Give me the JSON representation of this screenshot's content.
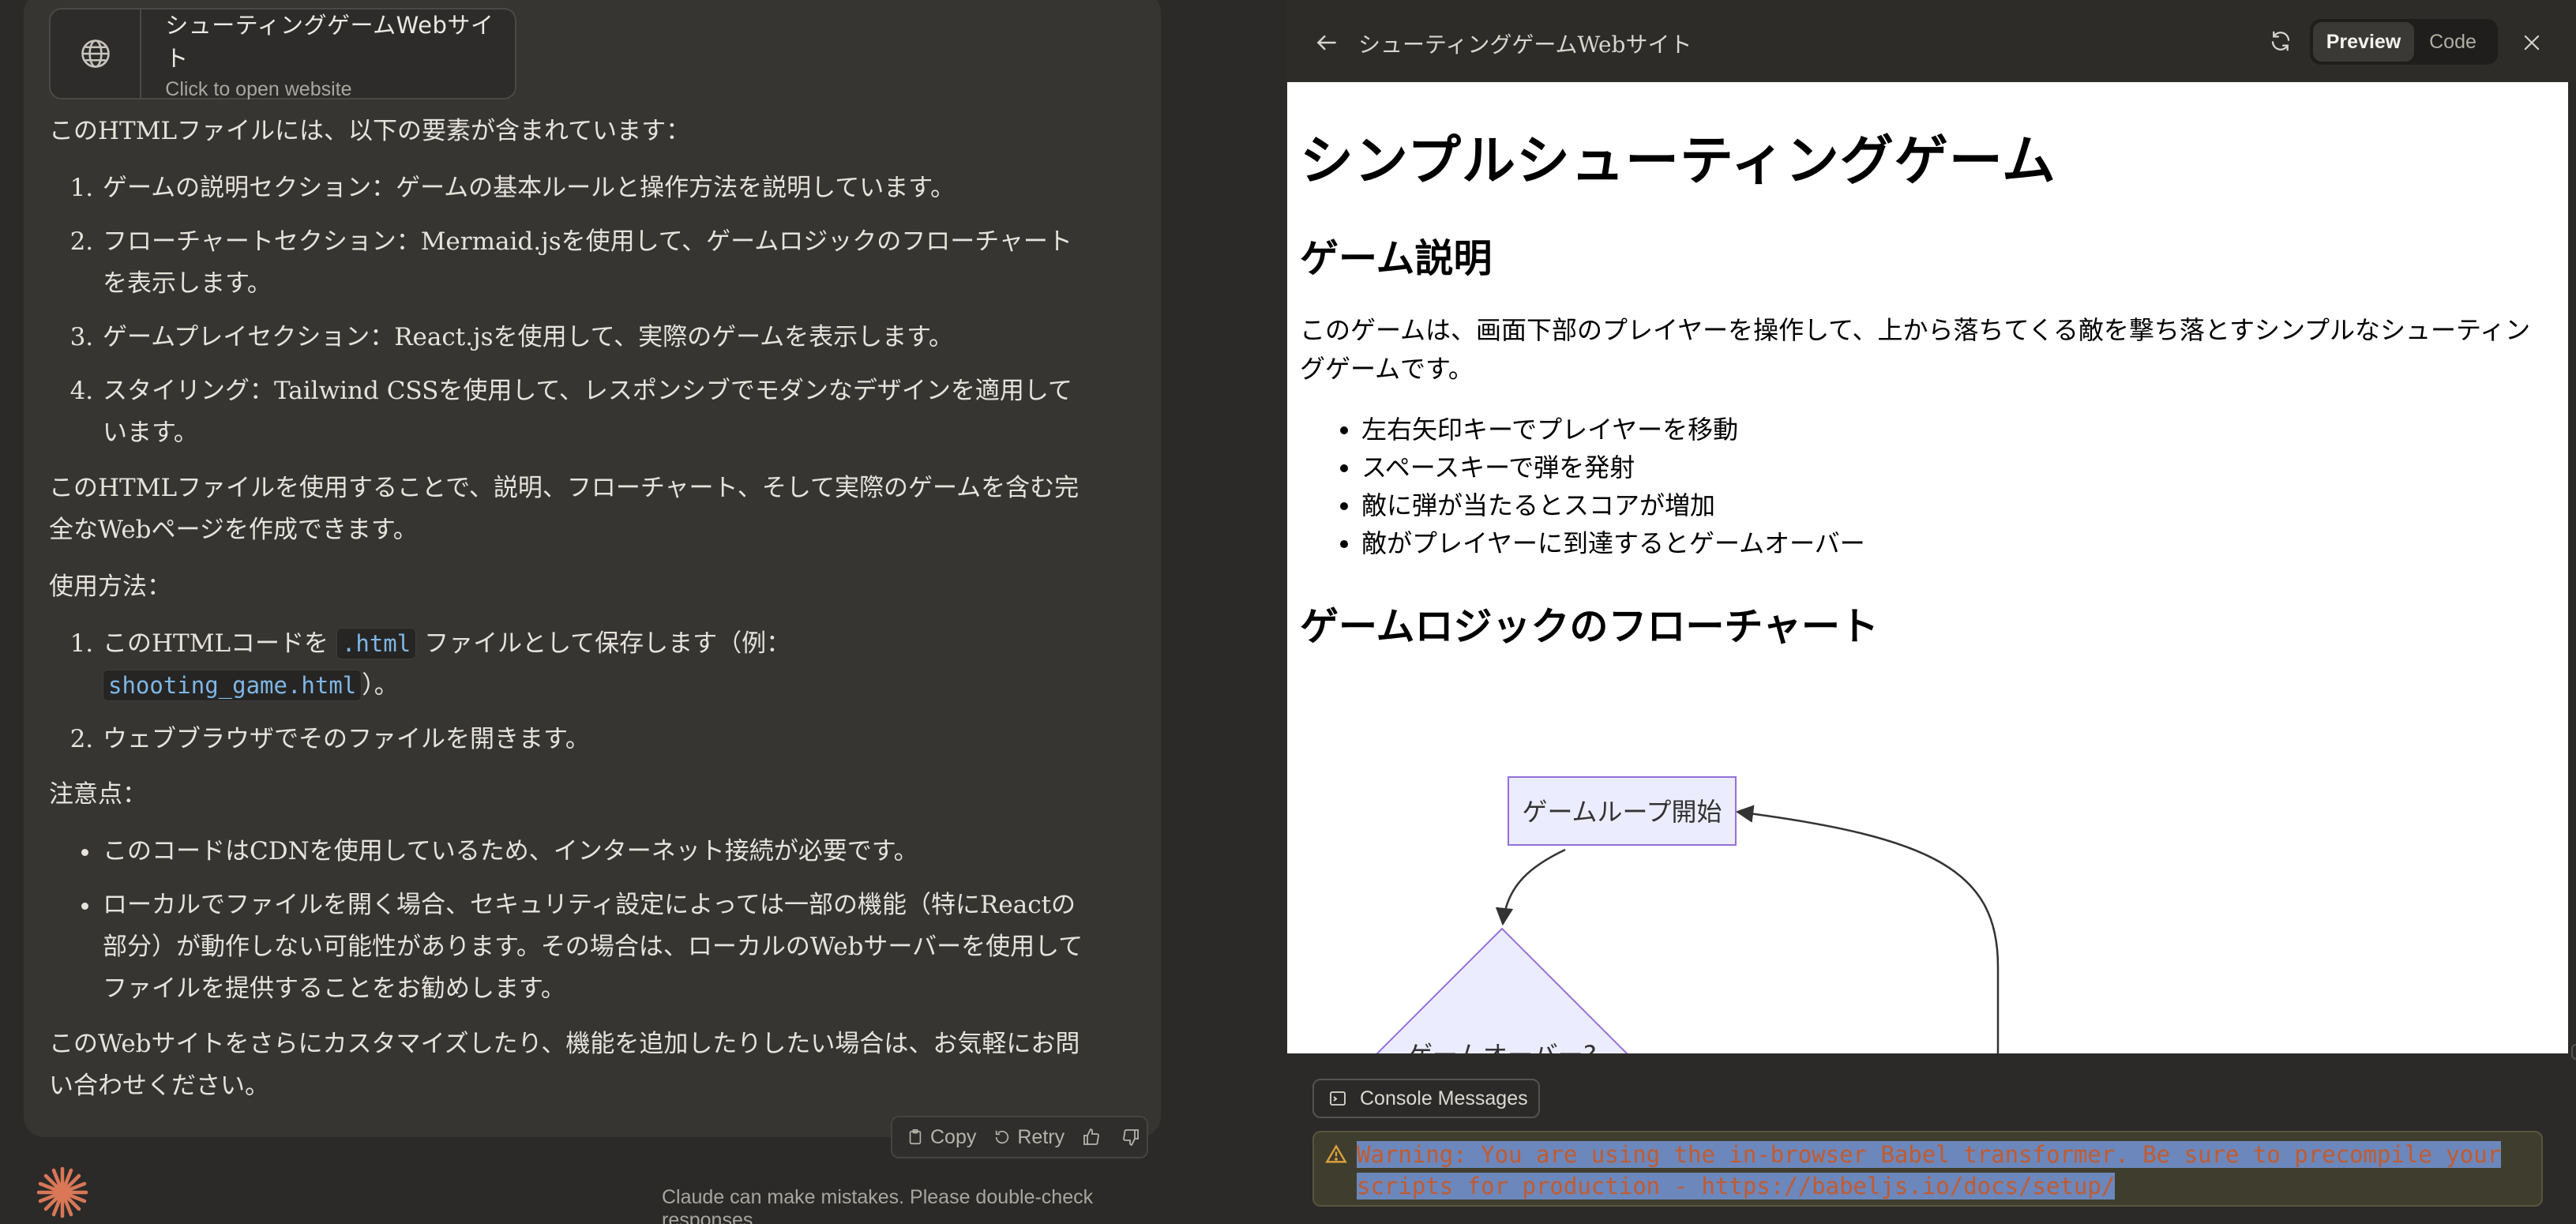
{
  "artifact_card": {
    "title": "シューティングゲームWebサイト",
    "subtitle": "Click to open website",
    "icon": "globe-icon"
  },
  "chat": {
    "intro": "このHTMLファイルには、以下の要素が含まれています：",
    "features": [
      "ゲームの説明セクション：ゲームの基本ルールと操作方法を説明しています。",
      "フローチャートセクション：Mermaid.jsを使用して、ゲームロジックのフローチャートを表示します。",
      "ゲームプレイセクション：React.jsを使用して、実際のゲームを表示します。",
      "スタイリング：Tailwind CSSを使用して、レスポンシブでモダンなデザインを適用しています。"
    ],
    "summary": "このHTMLファイルを使用することで、説明、フローチャート、そして実際のゲームを含む完全なWebページを作成できます。",
    "usage_heading": "使用方法：",
    "usage_step1_a": "このHTMLコードを",
    "usage_step1_code1": ".html",
    "usage_step1_b": "ファイルとして保存します（例：",
    "usage_step1_code2": "shooting_game.html",
    "usage_step1_c": "）。",
    "usage_step2": "ウェブブラウザでそのファイルを開きます。",
    "notes_heading": "注意点：",
    "notes": [
      "このコードはCDNを使用しているため、インターネット接続が必要です。",
      "ローカルでファイルを開く場合、セキュリティ設定によっては一部の機能（特にReactの部分）が動作しない可能性があります。その場合は、ローカルのWebサーバーを使用してファイルを提供することをお勧めします。"
    ],
    "closing": "このWebサイトをさらにカスタマイズしたり、機能を追加したりしたい場合は、お気軽にお問い合わせください。"
  },
  "actions": {
    "copy": "Copy",
    "retry": "Retry"
  },
  "disclaimer": "Claude can make mistakes. Please double-check responses.",
  "artifact_panel": {
    "title": "シューティングゲームWebサイト",
    "tabs": [
      "Preview",
      "Code"
    ],
    "active_tab": "Preview"
  },
  "preview": {
    "h1": "シンプルシューティングゲーム",
    "h2_description": "ゲーム説明",
    "description": "このゲームは、画面下部のプレイヤーを操作して、上から落ちてくる敵を撃ち落とすシンプルなシューティングゲームです。",
    "rules": [
      "左右矢印キーでプレイヤーを移動",
      "スペースキーで弾を発射",
      "敵に弾が当たるとスコアが増加",
      "敵がプレイヤーに到達するとゲームオーバー"
    ],
    "h2_flowchart": "ゲームロジックのフローチャート",
    "flow_nodes": {
      "start": "ゲームループ開始",
      "decision": "ゲームオーバー?"
    }
  },
  "console": {
    "tab_label": "Console Messages",
    "warning": "Warning: You are using the in-browser Babel transformer. Be sure to precompile your scripts for production - https://babeljs.io/docs/setup/"
  },
  "colors": {
    "flow_node_fill": "#ececff",
    "flow_node_stroke": "#9370db",
    "accent_logo": "#d97757",
    "warning_text": "#d88449"
  }
}
